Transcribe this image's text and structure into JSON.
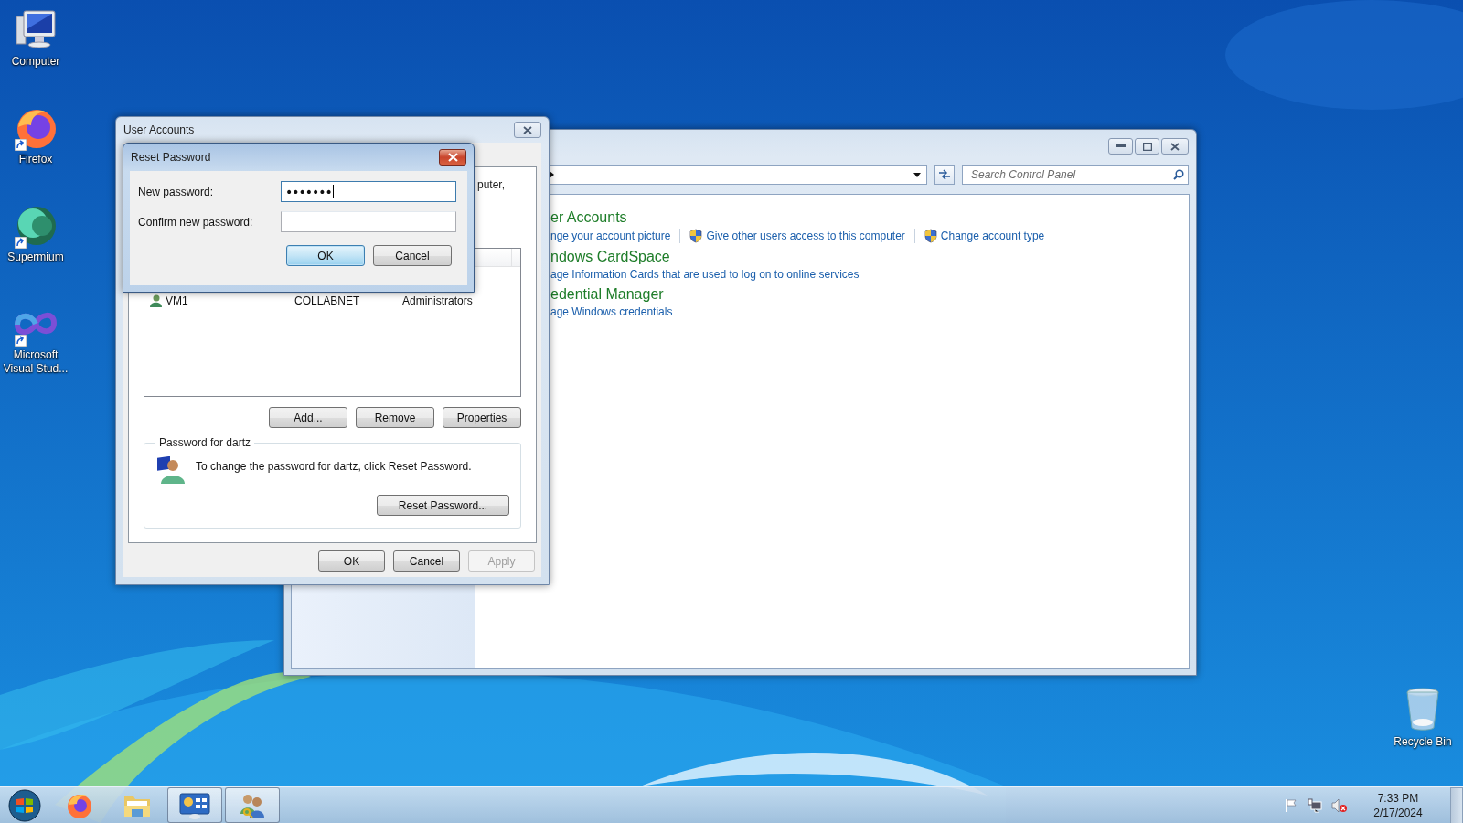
{
  "desktop_icons": [
    {
      "label": "Computer",
      "kind": "computer",
      "shortcut": false
    },
    {
      "label": "Firefox",
      "kind": "firefox",
      "shortcut": true
    },
    {
      "label": "Supermium",
      "kind": "supermium",
      "shortcut": true
    },
    {
      "label": "Microsoft Visual Stud...",
      "kind": "visualstudio",
      "shortcut": true
    }
  ],
  "recycle_bin": {
    "label": "Recycle Bin"
  },
  "control_panel": {
    "search": {
      "placeholder": "Search Control Panel"
    },
    "sections": [
      {
        "title": "er Accounts",
        "links": [
          {
            "label": "nge your account picture",
            "shield": false
          },
          {
            "label": "Give other users access to this computer",
            "shield": true
          },
          {
            "label": "Change account type",
            "shield": true
          }
        ]
      },
      {
        "title": "ndows CardSpace",
        "links": [
          {
            "label": "age Information Cards that are used to log on to online services",
            "shield": false
          }
        ]
      },
      {
        "title": "edential Manager",
        "links": [
          {
            "label": "age Windows credentials",
            "shield": false
          }
        ]
      }
    ]
  },
  "user_accounts_dialog": {
    "title": "User Accounts",
    "intro_fragment": "puter,",
    "users": [
      {
        "name": "VM1",
        "domain": "COLLABNET",
        "group": "Administrators"
      }
    ],
    "list_buttons": [
      "Add...",
      "Remove",
      "Properties"
    ],
    "password_group": {
      "title": "Password for dartz",
      "text": "To change the password for dartz, click Reset Password.",
      "button": "Reset Password..."
    },
    "buttons": [
      {
        "label": "OK",
        "disabled": false
      },
      {
        "label": "Cancel",
        "disabled": false
      },
      {
        "label": "Apply",
        "disabled": true
      }
    ]
  },
  "reset_password_dialog": {
    "title": "Reset Password",
    "fields": [
      {
        "label": "New password:",
        "value": "•••••••",
        "focused": true
      },
      {
        "label": "Confirm new password:",
        "focused": false
      }
    ],
    "buttons": [
      {
        "label": "OK",
        "default": true
      },
      {
        "label": "Cancel",
        "default": false
      }
    ]
  },
  "taskbar": {
    "items": [
      {
        "kind": "firefox",
        "active": false
      },
      {
        "kind": "explorer",
        "active": false
      },
      {
        "kind": "control_panel",
        "active": true
      },
      {
        "kind": "users",
        "active": true
      }
    ],
    "clock": {
      "time": "7:33 PM",
      "date": "2/17/2024"
    }
  }
}
